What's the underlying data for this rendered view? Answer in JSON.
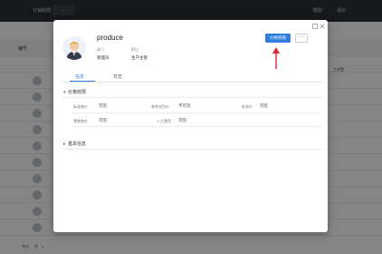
{
  "app": {
    "title": "分销权限",
    "tab": "...",
    "top_right_1": "帮助",
    "top_right_2": "退出",
    "grid_header_col": "编号",
    "grid_header_col2": "工作室",
    "footer_total": "合计",
    "footer_count": "共",
    "footer_value": "0"
  },
  "profile": {
    "name": "produce",
    "dept_label": "部门",
    "dept_value": "管理员",
    "title_label": "职位",
    "title_value": "生产主管"
  },
  "actions": {
    "primary": "价格权限",
    "more": "···"
  },
  "tabs": [
    {
      "label": "信息"
    },
    {
      "label": "日志"
    }
  ],
  "section_price": {
    "title": "价格权限",
    "fields": [
      {
        "label": "标准售价",
        "value": "可见"
      },
      {
        "label": "参考进货价",
        "value": "不可见"
      },
      {
        "label": "批发价",
        "value": "可见"
      },
      {
        "label": "零售售价",
        "value": "可见"
      },
      {
        "label": "人工费用",
        "value": "可见"
      }
    ]
  },
  "section_basic": {
    "title": "基本信息"
  },
  "colors": {
    "primary": "#2f7ddc",
    "arrow": "#e0243a"
  },
  "icons": {
    "minimize": "minimize-icon",
    "close": "close-icon",
    "collapse": "chevron-down-icon"
  }
}
